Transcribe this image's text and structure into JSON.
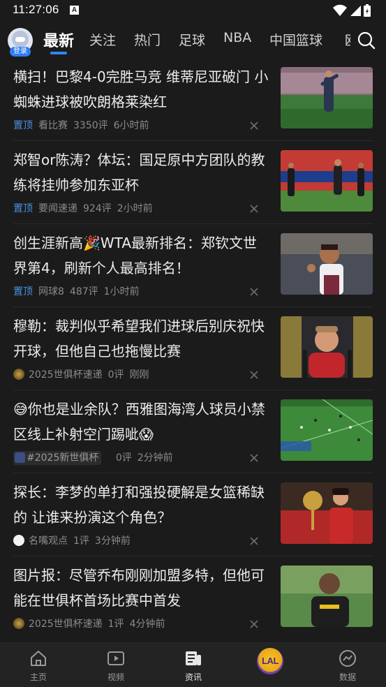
{
  "status_bar": {
    "time": "11:27:06",
    "a_icon": "A"
  },
  "header": {
    "login_badge": "登录",
    "tabs": [
      "最新",
      "关注",
      "热门",
      "足球",
      "NBA",
      "中国篮球",
      "欧"
    ],
    "active_tab": "最新",
    "accent": "#2f86ff"
  },
  "feed": [
    {
      "title": "横扫！巴黎4-0完胜马竞 维蒂尼亚破门 小蜘蛛进球被吹朗格莱染红",
      "pin": "置顶",
      "source": "看比赛",
      "comments": "3350评",
      "time": "6小时前"
    },
    {
      "title": "郑智or陈涛？体坛：国足原中方团队的教练将挂帅参加东亚杯",
      "pin": "置顶",
      "source": "要闻速递",
      "comments": "924评",
      "time": "2小时前"
    },
    {
      "title": "创生涯新高🎉WTA最新排名：郑钦文世界第4，刷新个人最高排名！",
      "pin": "置顶",
      "source": "网球8",
      "comments": "487评",
      "time": "1小时前"
    },
    {
      "title": "穆勒：裁判似乎希望我们进球后别庆祝快开球，但他自己也拖慢比赛",
      "pin": "",
      "source": "2025世俱杯速递",
      "comments": "0评",
      "time": "刚刚"
    },
    {
      "title": "😅你也是业余队？西雅图海湾人球员小禁区线上补射空门踢呲😱",
      "pin": "",
      "source": "#2025新世俱杯",
      "comments": "0评",
      "time": "2分钟前"
    },
    {
      "title": "探长：李梦的单打和强投硬解是女篮稀缺的 让谁来扮演这个角色？",
      "pin": "",
      "source": "名嘴观点",
      "comments": "1评",
      "time": "3分钟前"
    },
    {
      "title": "图片报：尽管乔布刚刚加盟多特，但他可能在世俱杯首场比赛中首发",
      "pin": "",
      "source": "2025世俱杯速递",
      "comments": "1评",
      "time": "4分钟前"
    }
  ],
  "bottom_nav": [
    {
      "label": "主页",
      "icon": "home-icon"
    },
    {
      "label": "视频",
      "icon": "video-icon"
    },
    {
      "label": "资讯",
      "icon": "news-icon"
    },
    {
      "label": "",
      "icon": "lakers-logo-icon",
      "logo_text": "LAL"
    },
    {
      "label": "数据",
      "icon": "data-icon"
    }
  ]
}
